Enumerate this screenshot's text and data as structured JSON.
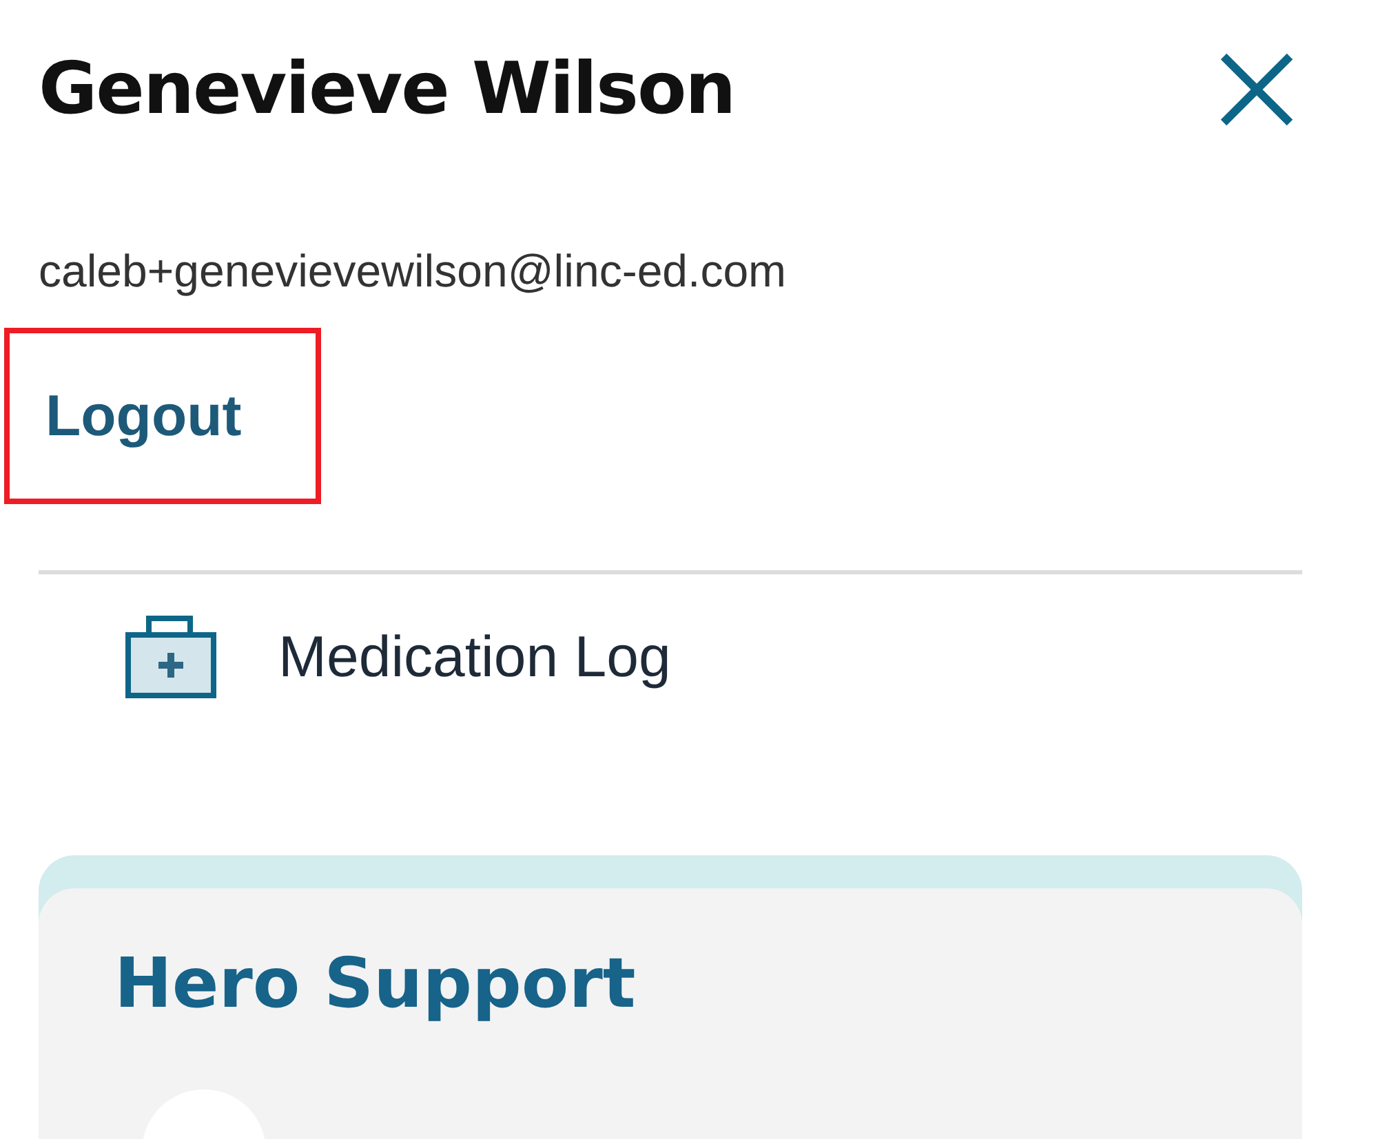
{
  "header": {
    "title": "Genevieve Wilson",
    "email": "caleb+genevievewilson@linc-ed.com"
  },
  "logout": {
    "label": "Logout",
    "highlighted": true
  },
  "menu_items": [
    {
      "label": "Medication Log"
    }
  ],
  "support_card": {
    "title": "Hero Support"
  }
}
